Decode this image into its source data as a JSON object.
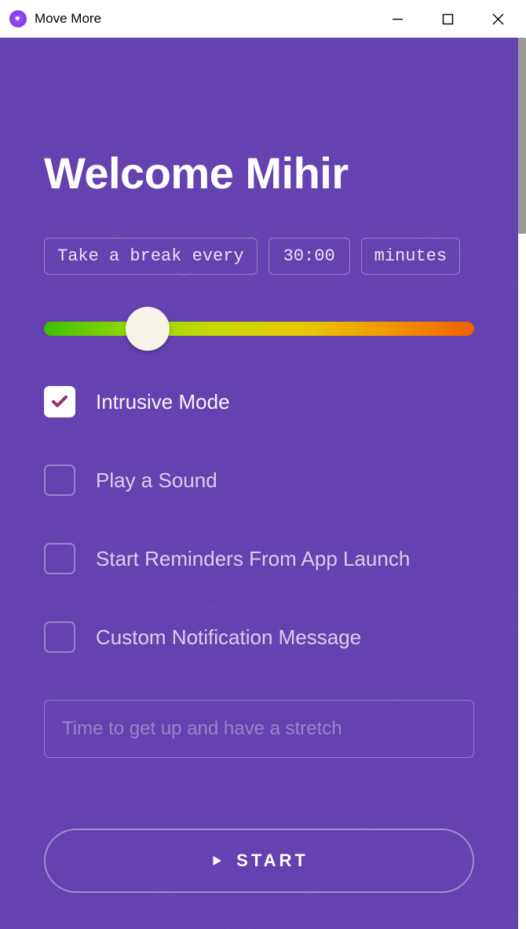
{
  "window": {
    "title": "Move More"
  },
  "heading": "Welcome Mihir",
  "break": {
    "prefix": "Take a break every",
    "time": "30:00",
    "suffix": "minutes"
  },
  "slider": {
    "position_percent": 24
  },
  "options": [
    {
      "label": "Intrusive Mode",
      "checked": true
    },
    {
      "label": "Play a Sound",
      "checked": false
    },
    {
      "label": "Start Reminders From App Launch",
      "checked": false
    },
    {
      "label": "Custom Notification Message",
      "checked": false
    }
  ],
  "message": {
    "placeholder": "Time to get up and have a stretch",
    "value": ""
  },
  "start_label": "START"
}
